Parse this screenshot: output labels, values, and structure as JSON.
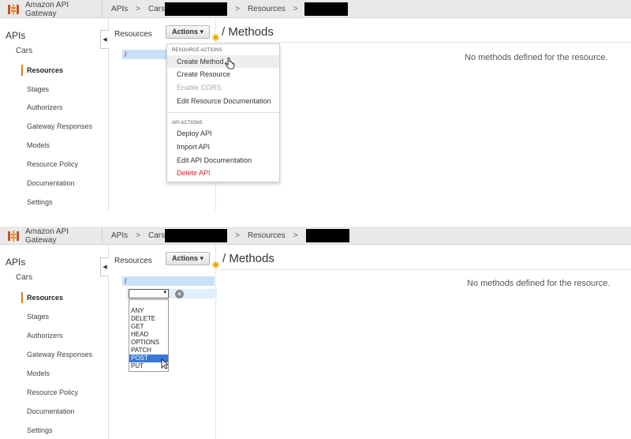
{
  "brand": {
    "name": "Amazon API Gateway"
  },
  "breadcrumb": {
    "apis": "APIs",
    "sep": ">",
    "api_name_prefix": "Cars",
    "resources": "Resources",
    "resource_prefix": "/"
  },
  "sidebar": {
    "title": "APIs",
    "api": "Cars",
    "items": [
      "Resources",
      "Stages",
      "Authorizers",
      "Gateway Responses",
      "Models",
      "Resource Policy",
      "Documentation",
      "Settings"
    ],
    "active": "Resources",
    "collapse_glyph": "◀"
  },
  "resources_panel": {
    "heading": "Resources",
    "root": "/"
  },
  "actions_button": {
    "label": "Actions ▾"
  },
  "methods_header": {
    "title": "/ Methods"
  },
  "empty_state": {
    "text": "No methods defined for the resource."
  },
  "actions_menu": {
    "resource_section": "RESOURCE ACTIONS",
    "resource_items": [
      {
        "label": "Create Method",
        "state": "hover"
      },
      {
        "label": "Create Resource",
        "state": "normal"
      },
      {
        "label": "Enable CORS",
        "state": "disabled"
      },
      {
        "label": "Edit Resource Documentation",
        "state": "normal"
      }
    ],
    "api_section": "API ACTIONS",
    "api_items": [
      {
        "label": "Deploy API",
        "state": "normal"
      },
      {
        "label": "Import API",
        "state": "normal"
      },
      {
        "label": "Edit API Documentation",
        "state": "normal"
      },
      {
        "label": "Delete API",
        "state": "danger"
      }
    ]
  },
  "method_select": {
    "value": "",
    "arrow": "▾",
    "clear_glyph": "×",
    "options": [
      "ANY",
      "DELETE",
      "GET",
      "HEAD",
      "OPTIONS",
      "PATCH",
      "POST",
      "PUT"
    ],
    "highlighted": "POST"
  },
  "colors": {
    "accent": "#e47911",
    "selected_row": "#c9e0f7",
    "option_selected": "#3778d6",
    "danger": "#d0222b",
    "topbar": "#e9e9e9"
  }
}
